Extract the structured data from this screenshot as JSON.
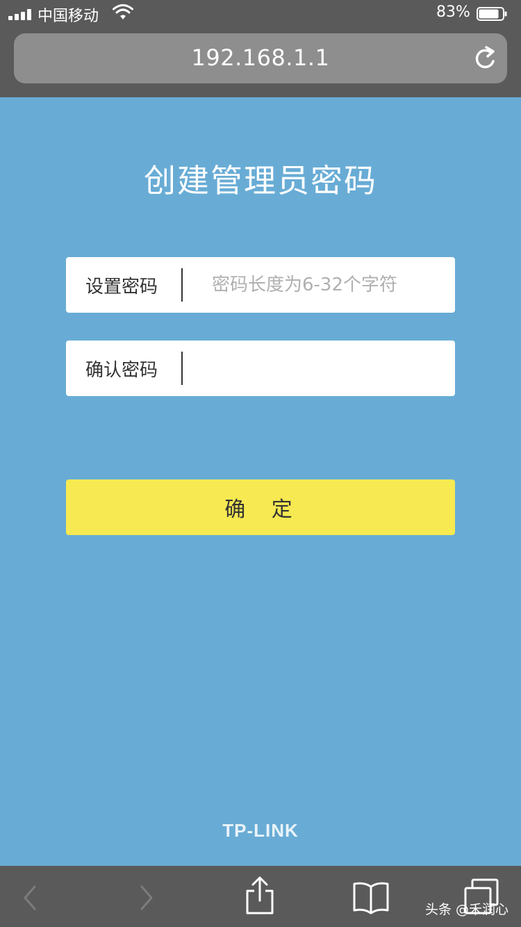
{
  "status_bar": {
    "carrier": "中国移动",
    "battery_percent": "83%",
    "battery_level": 0.83
  },
  "browser": {
    "url": "192.168.1.1"
  },
  "page": {
    "title": "创建管理员密码",
    "set_password": {
      "label": "设置密码",
      "placeholder": "密码长度为6-32个字符"
    },
    "confirm_password": {
      "label": "确认密码",
      "placeholder": ""
    },
    "confirm_button": "确 定",
    "brand": "TP-LINK"
  },
  "toolbar": {
    "icons": [
      "back-icon",
      "forward-icon",
      "share-icon",
      "bookmarks-icon",
      "tabs-icon"
    ]
  },
  "watermark": "头条 @禾润心",
  "colors": {
    "background": "#68acd5",
    "chrome": "#5a5a5a",
    "button": "#f7e951"
  }
}
